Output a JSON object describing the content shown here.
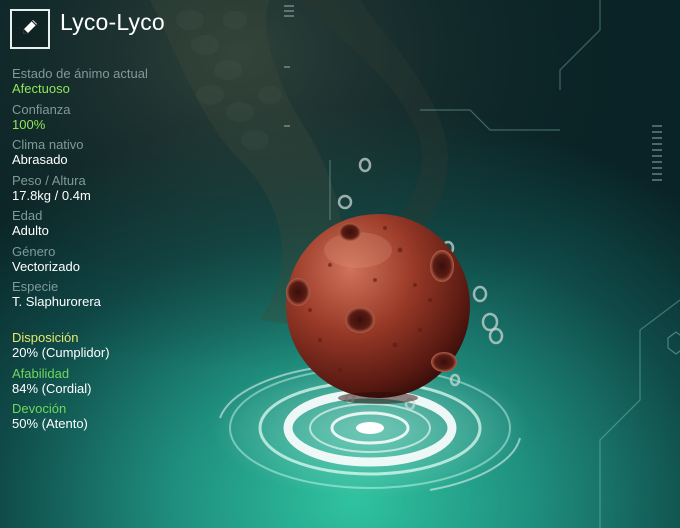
{
  "creature": {
    "name": "Lyco-Lyco"
  },
  "icons": {
    "edit": "pencil-icon"
  },
  "stats": [
    {
      "label": "Estado de ánimo actual",
      "value": "Afectuoso",
      "highlight": true
    },
    {
      "label": "Confianza",
      "value": "100%",
      "highlight": true
    },
    {
      "label": "Clima nativo",
      "value": "Abrasado",
      "highlight": false
    },
    {
      "label": "Peso / Altura",
      "value": "17.8kg / 0.4m",
      "highlight": false
    },
    {
      "label": "Edad",
      "value": "Adulto",
      "highlight": false
    },
    {
      "label": "Género",
      "value": "Vectorizado",
      "highlight": false
    },
    {
      "label": "Especie",
      "value": "T. Slaphurorera",
      "highlight": false
    }
  ],
  "traits": [
    {
      "label": "Disposición",
      "value": "20% (Cumplidor)",
      "color": "#e6e86a"
    },
    {
      "label": "Afabilidad",
      "value": "84% (Cordial)",
      "color": "#6fd85a"
    },
    {
      "label": "Devoción",
      "value": "50% (Atento)",
      "color": "#6fd85a"
    }
  ],
  "colors": {
    "background": "#0c2a2c",
    "accent_green": "#8fe65a",
    "label_gray": "#7f9a98"
  }
}
